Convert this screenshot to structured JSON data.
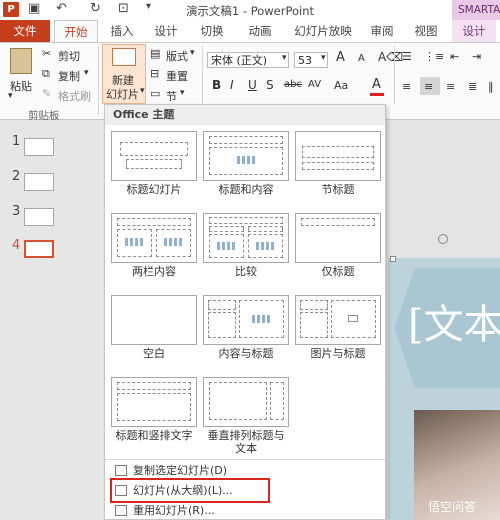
{
  "window": {
    "title": "演示文稿1 - PowerPoint",
    "context_tab": "SMARTA"
  },
  "tabs": [
    {
      "label": "文件"
    },
    {
      "label": "开始"
    },
    {
      "label": "插入"
    },
    {
      "label": "设计"
    },
    {
      "label": "切换"
    },
    {
      "label": "动画"
    },
    {
      "label": "幻灯片放映"
    },
    {
      "label": "审阅"
    },
    {
      "label": "视图"
    },
    {
      "label": "设计"
    }
  ],
  "ribbon": {
    "clipboard": {
      "paste": "粘贴",
      "cut": "剪切",
      "copy": "复制",
      "format_painter": "格式刷",
      "group": "剪贴板"
    },
    "slides": {
      "new_slide_line1": "新建",
      "new_slide_line2": "幻灯片",
      "layout": "版式",
      "reset": "重置",
      "section": "节"
    },
    "font": {
      "name": "宋体 (正文)",
      "size": "53",
      "grow": "A",
      "shrink": "A",
      "bold": "B",
      "italic": "I",
      "underline": "U",
      "shadow": "S",
      "strike": "abc",
      "spacing": "AV",
      "case": "Aa",
      "color": "A"
    }
  },
  "slides_pane": {
    "numbers": [
      "1",
      "2",
      "3",
      "4"
    ]
  },
  "dropdown": {
    "header": "Office 主题",
    "layouts": [
      {
        "label": "标题幻灯片"
      },
      {
        "label": "标题和内容"
      },
      {
        "label": "节标题"
      },
      {
        "label": "两栏内容"
      },
      {
        "label": "比较"
      },
      {
        "label": "仅标题"
      },
      {
        "label": "空白"
      },
      {
        "label": "内容与标题"
      },
      {
        "label": "图片与标题"
      },
      {
        "label": "标题和竖排文字"
      },
      {
        "label": "垂直排列标题与",
        "label2": "文本"
      }
    ],
    "commands": [
      {
        "label": "复制选定幻灯片(D)"
      },
      {
        "label": "幻灯片(从大纲)(L)..."
      },
      {
        "label": "重用幻灯片(R)..."
      }
    ]
  },
  "slide": {
    "text": "[文本"
  },
  "watermark": "悟空问答",
  "colors": {
    "accent": "#c43e1c",
    "highlight_box": "#d9251d",
    "font_color_bar": "#e02020"
  }
}
